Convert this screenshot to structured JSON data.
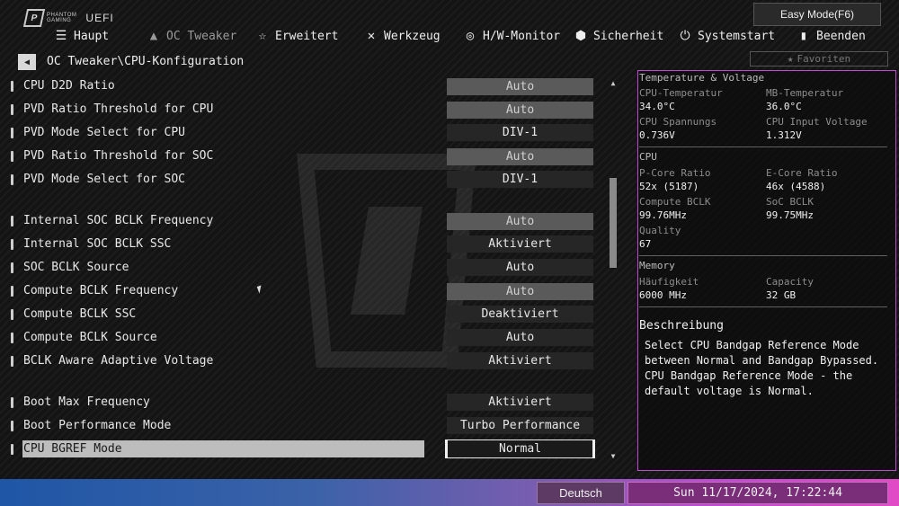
{
  "header": {
    "logo_line1": "PHANTOM",
    "logo_line2": "GAMING",
    "logo_uefi": "UEFI",
    "easy_mode": "Easy Mode(F6)"
  },
  "nav": [
    {
      "label": "Haupt",
      "icon": "list-icon"
    },
    {
      "label": "OC Tweaker",
      "icon": "rocket-icon"
    },
    {
      "label": "Erweitert",
      "icon": "star-icon"
    },
    {
      "label": "Werkzeug",
      "icon": "tools-icon"
    },
    {
      "label": "H/W-Monitor",
      "icon": "monitor-icon"
    },
    {
      "label": "Sicherheit",
      "icon": "shield-icon"
    },
    {
      "label": "Systemstart",
      "icon": "power-icon"
    },
    {
      "label": "Beenden",
      "icon": "exit-icon"
    }
  ],
  "breadcrumb": "OC Tweaker\\CPU-Konfiguration",
  "favorites": "Favoriten",
  "settings": [
    {
      "label": "CPU D2D Ratio",
      "value": "Auto"
    },
    {
      "label": "PVD Ratio Threshold for CPU",
      "value": "Auto"
    },
    {
      "label": "PVD Mode Select for CPU",
      "value": "DIV-1"
    },
    {
      "label": "PVD Ratio Threshold for SOC",
      "value": "Auto"
    },
    {
      "label": "PVD Mode Select for SOC",
      "value": "DIV-1"
    },
    {
      "label": "Internal SOC BCLK Frequency",
      "value": "Auto"
    },
    {
      "label": "Internal SOC BCLK SSC",
      "value": "Aktiviert"
    },
    {
      "label": "SOC BCLK Source",
      "value": "Auto"
    },
    {
      "label": "Compute BCLK Frequency",
      "value": "Auto"
    },
    {
      "label": "Compute BCLK SSC",
      "value": "Deaktiviert"
    },
    {
      "label": "Compute BCLK Source",
      "value": "Auto"
    },
    {
      "label": "BCLK Aware Adaptive Voltage",
      "value": "Aktiviert"
    },
    {
      "label": "Boot Max Frequency",
      "value": "Aktiviert"
    },
    {
      "label": "Boot Performance Mode",
      "value": "Turbo Performance"
    },
    {
      "label": "CPU BGREF Mode",
      "value": "Normal"
    }
  ],
  "panel": {
    "tv_title": "Temperature & Voltage",
    "cpu_temp_label": "CPU-Temperatur",
    "cpu_temp": "34.0°C",
    "mb_temp_label": "MB-Temperatur",
    "mb_temp": "36.0°C",
    "cpu_volt_label": "CPU Spannungs",
    "cpu_volt": "0.736V",
    "cpu_input_label": "CPU Input Voltage",
    "cpu_input": "1.312V",
    "cpu_title": "CPU",
    "pcore_label": "P-Core Ratio",
    "pcore": "52x (5187)",
    "ecore_label": "E-Core Ratio",
    "ecore": "46x (4588)",
    "cbclk_label": "Compute BCLK",
    "cbclk": "99.76MHz",
    "sbclk_label": "SoC BCLK",
    "sbclk": "99.75MHz",
    "quality_label": "Quality",
    "quality": "67",
    "mem_title": "Memory",
    "freq_label": "Häufigkeit",
    "freq": "6000 MHz",
    "cap_label": "Capacity",
    "cap": "32 GB",
    "desc_title": "Beschreibung",
    "desc_body": "Select CPU Bandgap Reference Mode\nbetween Normal and Bandgap Bypassed.\nCPU Bandgap Reference Mode - the\ndefault voltage is Normal."
  },
  "footer": {
    "language": "Deutsch",
    "datetime": "Sun 11/17/2024, 17:22:44"
  }
}
